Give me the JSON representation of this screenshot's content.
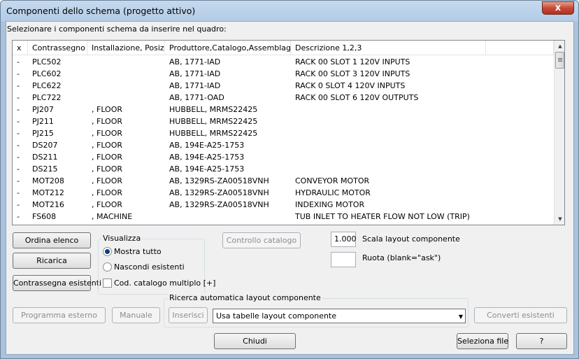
{
  "window": {
    "title": "Componenti dello schema (progetto attivo)",
    "close_glyph": "x"
  },
  "instruction": "Selezionare i componenti schema da inserire nel quadro:",
  "list": {
    "columns": [
      "x",
      "Contrassegno",
      "Installazione, Posiz...",
      "Produttore,Catalogo,Assemblaggio",
      "Descrizione 1,2,3",
      ""
    ],
    "rows": [
      {
        "x": "-",
        "tag": "PLC502",
        "inst": "",
        "mfg": "AB, 1771-IAD",
        "desc": "RACK 00 SLOT 1 120V INPUTS"
      },
      {
        "x": "-",
        "tag": "PLC602",
        "inst": "",
        "mfg": "AB, 1771-IAD",
        "desc": "RACK 00 SLOT 3 120V INPUTS"
      },
      {
        "x": "-",
        "tag": "PLC622",
        "inst": "",
        "mfg": "AB, 1771-IAD",
        "desc": "RACK 0 SLOT 4 120V INPUTS"
      },
      {
        "x": "-",
        "tag": "PLC722",
        "inst": "",
        "mfg": "AB, 1771-OAD",
        "desc": "RACK 00 SLOT 6 120V OUTPUTS"
      },
      {
        "x": "-",
        "tag": "PJ207",
        "inst": ", FLOOR",
        "mfg": "HUBBELL, MRMS22425",
        "desc": ""
      },
      {
        "x": "-",
        "tag": "PJ211",
        "inst": ", FLOOR",
        "mfg": "HUBBELL, MRMS22425",
        "desc": ""
      },
      {
        "x": "-",
        "tag": "PJ215",
        "inst": ", FLOOR",
        "mfg": "HUBBELL, MRMS22425",
        "desc": ""
      },
      {
        "x": "-",
        "tag": "DS207",
        "inst": ", FLOOR",
        "mfg": "AB, 194E-A25-1753",
        "desc": ""
      },
      {
        "x": "-",
        "tag": "DS211",
        "inst": ", FLOOR",
        "mfg": "AB, 194E-A25-1753",
        "desc": ""
      },
      {
        "x": "-",
        "tag": "DS215",
        "inst": ", FLOOR",
        "mfg": "AB, 194E-A25-1753",
        "desc": ""
      },
      {
        "x": "-",
        "tag": "MOT208",
        "inst": ", FLOOR",
        "mfg": "AB, 1329RS-ZA00518VNH",
        "desc": "CONVEYOR MOTOR"
      },
      {
        "x": "-",
        "tag": "MOT212",
        "inst": ", FLOOR",
        "mfg": "AB, 1329RS-ZA00518VNH",
        "desc": "HYDRAULIC MOTOR"
      },
      {
        "x": "-",
        "tag": "MOT216",
        "inst": ", FLOOR",
        "mfg": "AB, 1329RS-ZA00518VNH",
        "desc": "INDEXING MOTOR"
      },
      {
        "x": "-",
        "tag": "FS608",
        "inst": ", MACHINE",
        "mfg": "",
        "desc": "TUB INLET TO HEATER FLOW NOT LOW (TRIP)"
      }
    ]
  },
  "buttons": {
    "sort": "Ordina elenco",
    "reload": "Ricarica",
    "mark_existing": "Contrassegna esistenti",
    "catalog_check": "Controllo catalogo",
    "external_program": "Programma esterno",
    "manual": "Manuale",
    "insert": "Inserisci",
    "convert_existing": "Converti esistenti",
    "close": "Chiudi",
    "select_file": "Seleziona file",
    "help": "?"
  },
  "display": {
    "group_label": "Visualizza",
    "show_all": "Mostra tutto",
    "hide_existing": "Nascondi esistenti",
    "multi_catalog": "Cod. catalogo multiplo [+]",
    "selected": "show_all"
  },
  "scale": {
    "value": "1.000",
    "label": "Scala layout componente"
  },
  "rotate": {
    "value": "",
    "label": "Ruota (blank=\"ask\")"
  },
  "auto_search": {
    "group_label": "Ricerca automatica layout componente",
    "combo_value": "Usa tabelle layout componente"
  },
  "colors": {
    "accent": "#0c3f86",
    "frame": "#aac3dd"
  }
}
